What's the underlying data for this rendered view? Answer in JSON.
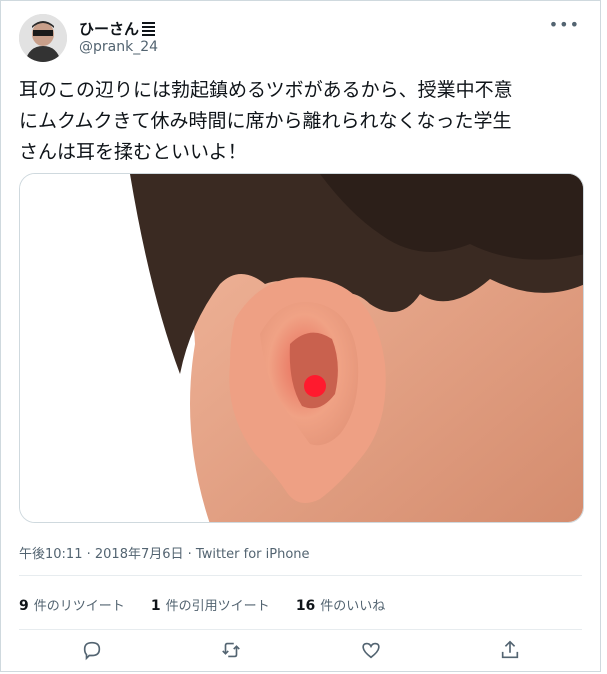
{
  "tweet": {
    "display_name": "ひーさん",
    "handle": "@prank_24",
    "text_lines": [
      "耳のこの辺りには勃起鎮めるツボがあるから、授業中不意",
      "にムクムクきて休み時間に席から離れられなくなった学生",
      "さんは耳を揉むといいよ！"
    ],
    "timestamp": "午後10:11",
    "date": "2018年7月6日",
    "separator": " · ",
    "source": "Twitter for iPhone",
    "more_label": "•••"
  },
  "stats": {
    "retweets_count": "9",
    "retweets_label": "件のリツイート",
    "quotes_count": "1",
    "quotes_label": "件の引用ツイート",
    "likes_count": "16",
    "likes_label": "件のいいね"
  },
  "media": {
    "image_subject": "ear",
    "highlight_color": "#ff1a2e"
  },
  "icons": [
    "reply-icon",
    "retweet-icon",
    "like-icon",
    "share-icon"
  ]
}
